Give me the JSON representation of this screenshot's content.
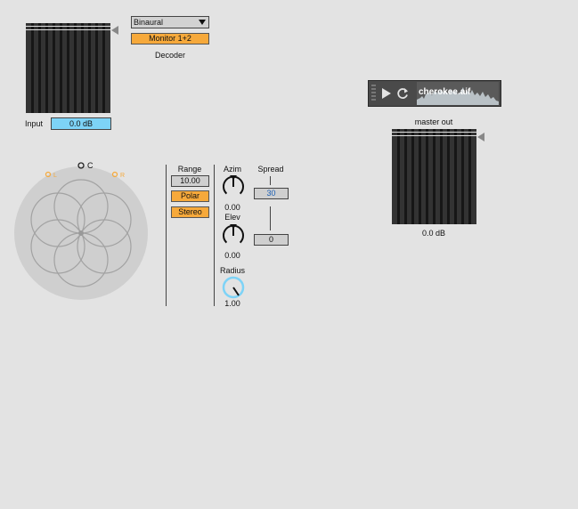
{
  "decoder": {
    "mode_value": "Binaural",
    "monitor_label": "Monitor 1+2",
    "label": "Decoder"
  },
  "input": {
    "label": "Input",
    "gain_value": "0.0 dB"
  },
  "speakers": {
    "center_label": "C",
    "left_label": "L",
    "right_label": "R"
  },
  "range": {
    "label": "Range",
    "value": "10.00",
    "polar_label": "Polar",
    "stereo_label": "Stereo"
  },
  "azim": {
    "label": "Azim",
    "value": "0.00"
  },
  "elev": {
    "label": "Elev",
    "value": "0.00"
  },
  "radius": {
    "label": "Radius",
    "value": "1.00"
  },
  "spread": {
    "label": "Spread",
    "top_value": "30",
    "bottom_value": "0"
  },
  "player": {
    "filename": "cherokee.aif"
  },
  "master": {
    "label": "master out",
    "gain_value": "0.0 dB"
  },
  "colors": {
    "accent_orange": "#f6a93b",
    "accent_blue": "#7dd3f7",
    "meter_bg": "#2b2b2b"
  }
}
